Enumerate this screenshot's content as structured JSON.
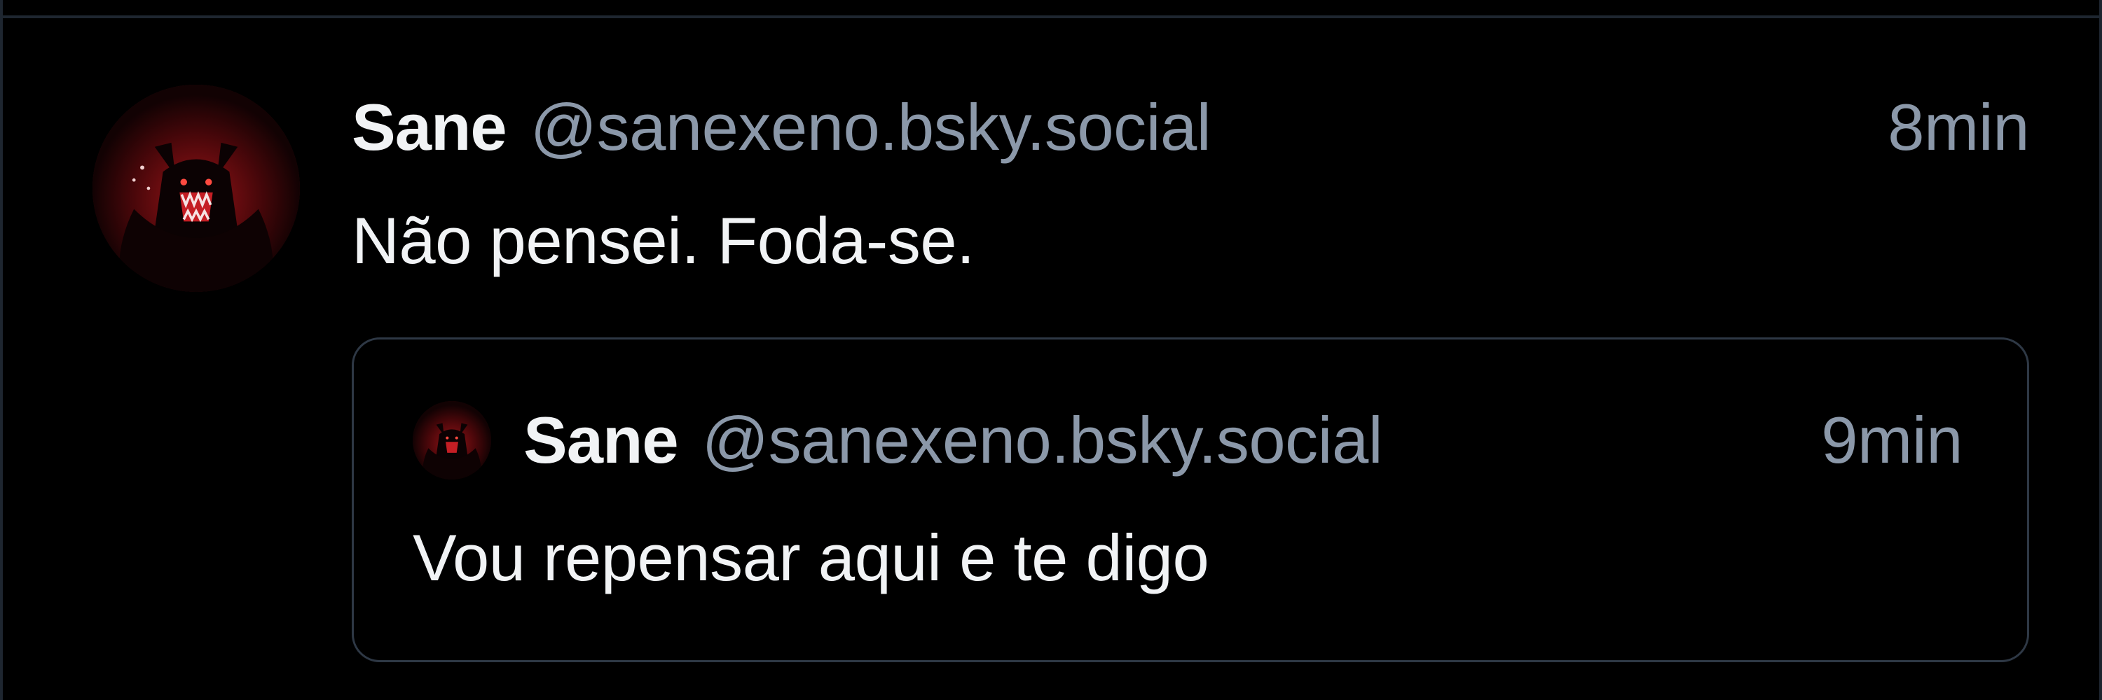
{
  "colors": {
    "background": "#000000",
    "divider": "#1e2630",
    "text_primary": "#f1f3f5",
    "text_secondary": "#8b98a9",
    "quote_border": "#2e3845"
  },
  "post": {
    "author": {
      "display_name": "Sane",
      "handle": "@sanexeno.bsky.social",
      "avatar_icon": "demon-avatar-icon"
    },
    "timestamp": "8min",
    "text": "Não pensei. Foda-se.",
    "quote": {
      "author": {
        "display_name": "Sane",
        "handle": "@sanexeno.bsky.social",
        "avatar_icon": "demon-avatar-icon"
      },
      "timestamp": "9min",
      "text": "Vou repensar aqui e te digo"
    }
  }
}
